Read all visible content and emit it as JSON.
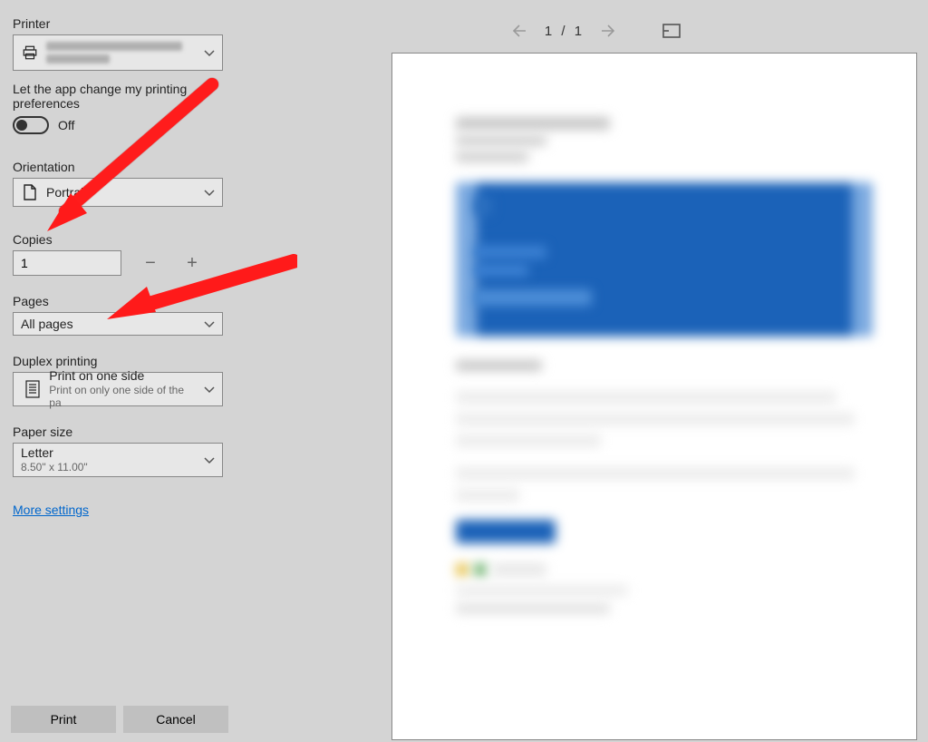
{
  "printer": {
    "label": "Printer"
  },
  "appChange": {
    "label": "Let the app change my printing preferences",
    "state_label": "Off"
  },
  "orientation": {
    "label": "Orientation",
    "value": "Portrait"
  },
  "copies": {
    "label": "Copies",
    "value": "1"
  },
  "pages": {
    "label": "Pages",
    "value": "All pages"
  },
  "duplex": {
    "label": "Duplex printing",
    "value_primary": "Print on one side",
    "value_secondary": "Print on only one side of the pa"
  },
  "paper": {
    "label": "Paper size",
    "value_primary": "Letter",
    "value_secondary": "8.50\" x 11.00\""
  },
  "more_settings": "More settings",
  "footer": {
    "print": "Print",
    "cancel": "Cancel"
  },
  "preview": {
    "page_current": "1",
    "page_sep": "/",
    "page_total": "1"
  }
}
